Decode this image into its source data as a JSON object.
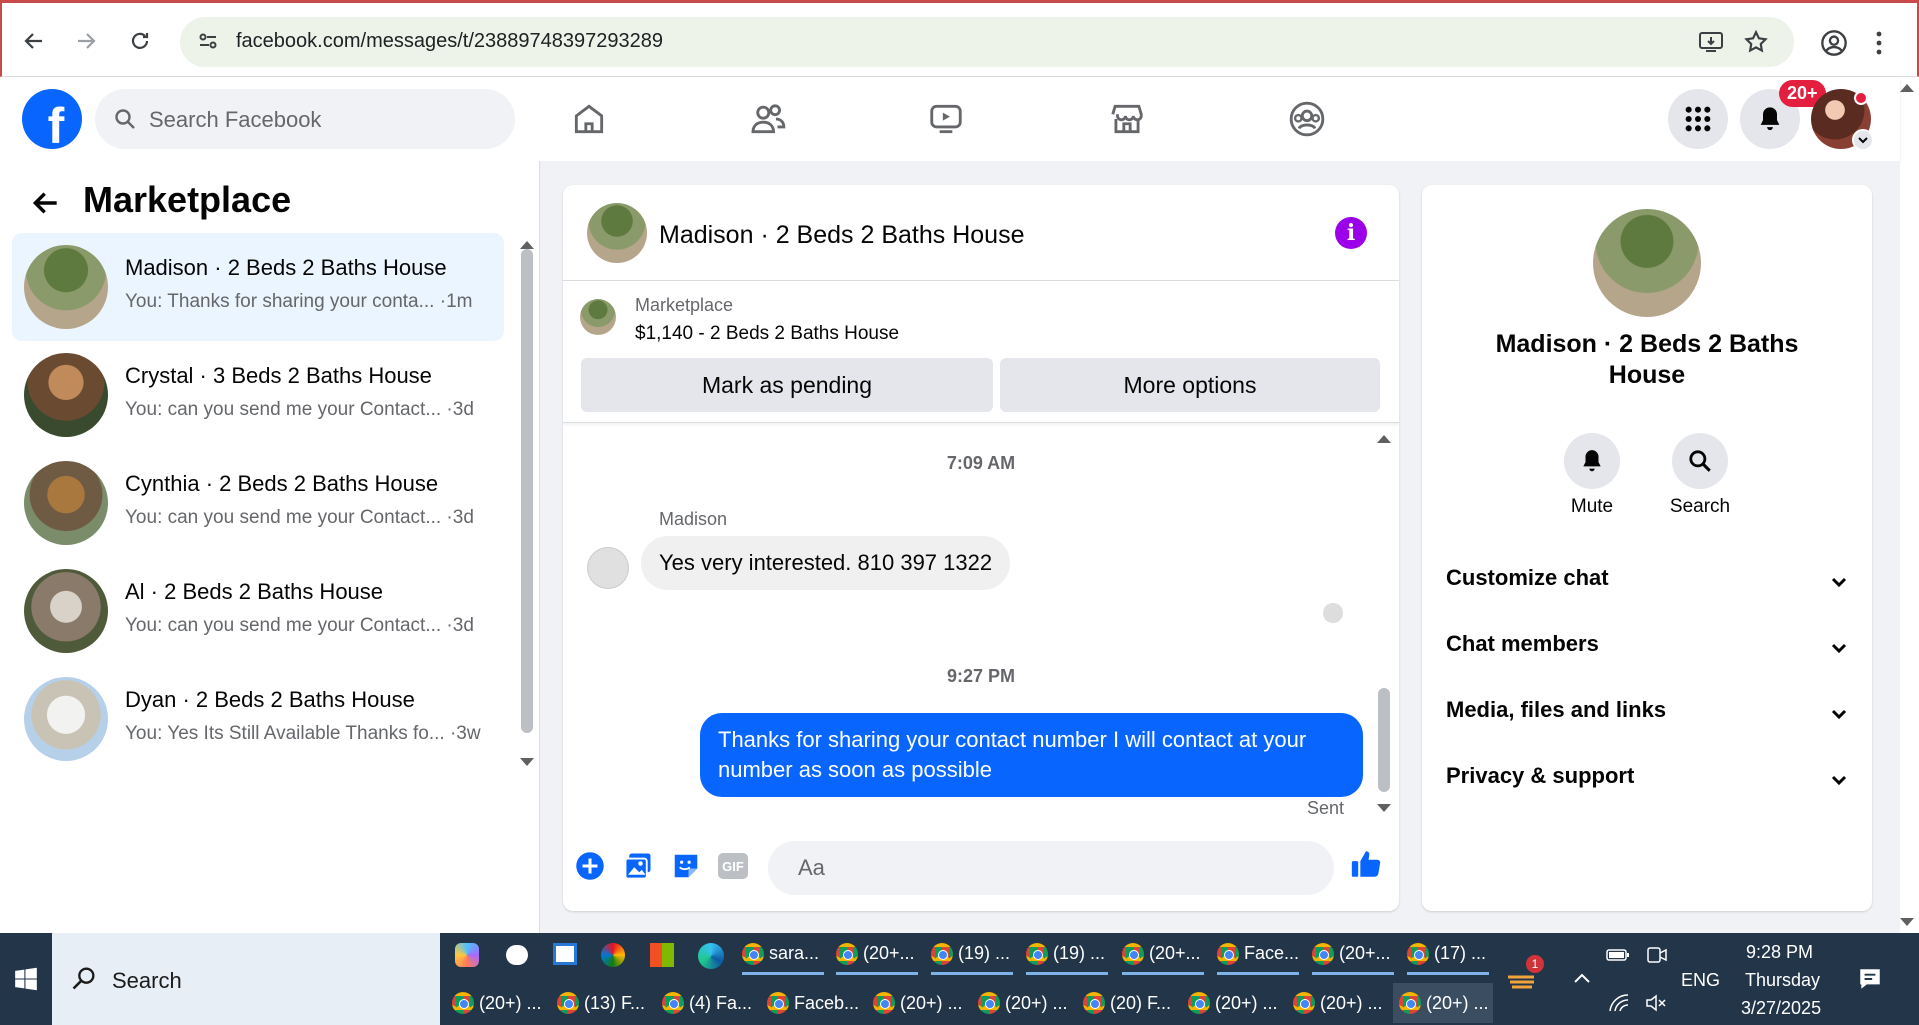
{
  "browser": {
    "url": "facebook.com/messages/t/23889748397293289"
  },
  "fb": {
    "logo": "f",
    "search_placeholder": "Search Facebook",
    "notif_badge": "20+"
  },
  "left": {
    "title": "Marketplace",
    "conversations": [
      {
        "title": "Madison · 2 Beds 2 Baths House",
        "preview": "You: Thanks for sharing your conta... ·1m",
        "active": true
      },
      {
        "title": "Crystal · 3 Beds 2 Baths House",
        "preview": "You: can you send me your Contact... ·3d"
      },
      {
        "title": "Cynthia · 2 Beds 2 Baths House",
        "preview": "You: can you send me your Contact... ·3d"
      },
      {
        "title": "Al · 2 Beds 2 Baths House",
        "preview": "You: can you send me your Contact... ·3d"
      },
      {
        "title": "Dyan · 2 Beds 2 Baths House",
        "preview": "You: Yes Its Still Available Thanks fo... ·3w"
      }
    ]
  },
  "chat": {
    "title": "Madison · 2 Beds 2 Baths House",
    "listing_source": "Marketplace",
    "listing_price": "$1,140 - 2 Beds 2 Baths House",
    "btn_pending": "Mark as pending",
    "btn_more": "More options",
    "time1": "7:09 AM",
    "sender": "Madison",
    "msg_in": "Yes very interested. 810 397 1322",
    "time2": "9:27 PM",
    "msg_out": "Thanks for sharing your contact number I will contact at your number as soon as possible",
    "sent": "Sent",
    "composer_placeholder": "Aa",
    "gif": "GIF"
  },
  "right": {
    "title": "Madison · 2 Beds 2 Baths House",
    "mute": "Mute",
    "search": "Search",
    "rows": [
      "Customize chat",
      "Chat members",
      "Media, files and links",
      "Privacy & support"
    ]
  },
  "taskbar": {
    "search": "Search",
    "apps_row1": [
      "sara...",
      "(20+...",
      "(19) ...",
      "(19) ...",
      "(20+...",
      "Face...",
      "(20+...",
      "(17) ..."
    ],
    "apps_row2": [
      "(20+) ...",
      "(13) F...",
      "(4) Fa...",
      "Faceb...",
      "(20+) ...",
      "(20+) ...",
      "(20) F...",
      "(20+) ...",
      "(20+) ...",
      "(20+) ..."
    ],
    "lang": "ENG",
    "time": "9:28 PM",
    "day": "Thursday",
    "date": "3/27/2025",
    "weather_badge": "1"
  },
  "colors": {
    "fb_blue": "#0866ff",
    "info_purple": "#9b00e8",
    "active_row": "#ebf5ff"
  }
}
